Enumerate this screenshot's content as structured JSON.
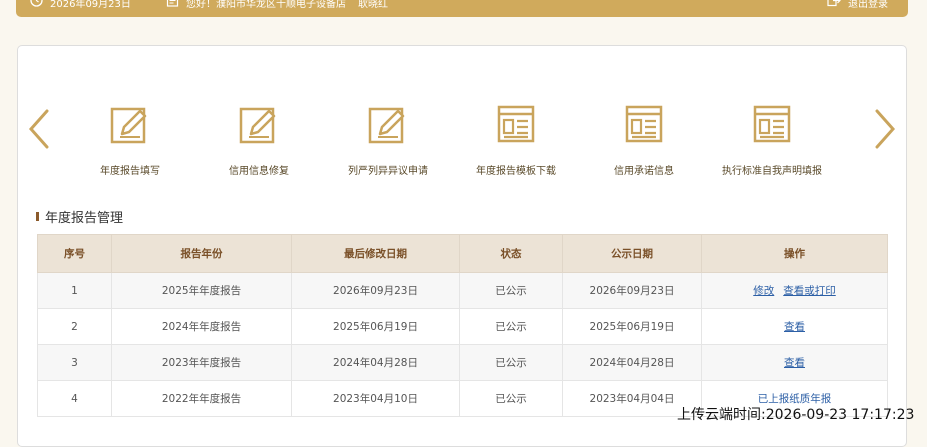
{
  "topbar": {
    "date": "2026年09月23日",
    "greeting": "您好！濮阳市华龙区千顺电子设备店",
    "account": "耿晓红",
    "logout": "退出登录"
  },
  "quick_links": [
    {
      "label": "年度报告填写",
      "icon": "edit-form-icon"
    },
    {
      "label": "信用信息修复",
      "icon": "edit-form-icon"
    },
    {
      "label": "列严列异异议申请",
      "icon": "edit-form-icon"
    },
    {
      "label": "年度报告模板下载",
      "icon": "document-window-icon"
    },
    {
      "label": "信用承诺信息",
      "icon": "document-window-icon"
    },
    {
      "label": "执行标准自我声明填报",
      "icon": "document-window-icon"
    }
  ],
  "section": {
    "title": "年度报告管理"
  },
  "table": {
    "headers": [
      "序号",
      "报告年份",
      "最后修改日期",
      "状态",
      "公示日期",
      "操作"
    ],
    "rows": [
      {
        "no": "1",
        "year": "2025年年度报告",
        "modified": "2026年09月23日",
        "status": "已公示",
        "published": "2026年09月23日",
        "actions": [
          "修改",
          "查看或打印"
        ]
      },
      {
        "no": "2",
        "year": "2024年年度报告",
        "modified": "2025年06月19日",
        "status": "已公示",
        "published": "2025年06月19日",
        "actions": [
          "查看"
        ]
      },
      {
        "no": "3",
        "year": "2023年年度报告",
        "modified": "2024年04月28日",
        "status": "已公示",
        "published": "2024年04月28日",
        "actions": [
          "查看"
        ]
      },
      {
        "no": "4",
        "year": "2022年年度报告",
        "modified": "2023年04月10日",
        "status": "已公示",
        "published": "2023年04月04日",
        "actions": [
          "已上报纸质年报"
        ]
      }
    ]
  },
  "stamp": "上传云端时间:2026-09-23 17:17:23",
  "colors": {
    "accent": "#d0aa5c",
    "header_bg": "#ece3d6",
    "link": "#2c5fa6"
  }
}
